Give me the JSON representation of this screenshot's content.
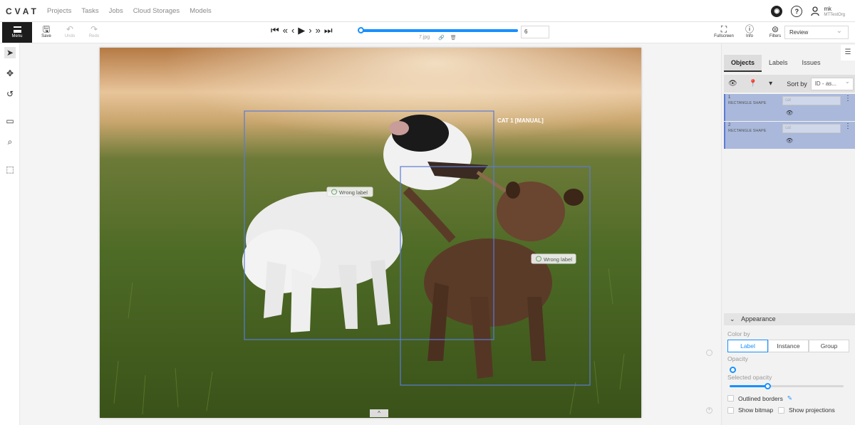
{
  "app": {
    "logo": "CVAT"
  },
  "nav": [
    "Projects",
    "Tasks",
    "Jobs",
    "Cloud Storages",
    "Models"
  ],
  "header_icons": [
    "github-icon",
    "help-icon",
    "user-icon"
  ],
  "user": {
    "name": "mk",
    "org": "MTTestOrg"
  },
  "toolbar": {
    "menu_label": "Menu",
    "save_label": "Save",
    "undo_label": "Undo",
    "redo_label": "Redo",
    "frame_number": "6",
    "frame_progress": 1.0,
    "filename": "7.jpg",
    "fullscreen_label": "Fullscreen",
    "info_label": "Info",
    "filters_label": "Filters",
    "mode_value": "Review"
  },
  "canvas": {
    "box1_label": "CAT 1 [MANUAL]",
    "issue1_text": "Wrong label",
    "issue2_text": "Wrong label"
  },
  "sidebar": {
    "tabs": [
      "Objects",
      "Labels",
      "Issues"
    ],
    "sort_label": "Sort by",
    "sort_value": "ID - as...",
    "objects": [
      {
        "id": "1",
        "type": "RECTANGLE SHAPE",
        "label": "cat"
      },
      {
        "id": "2",
        "type": "RECTANGLE SHAPE",
        "label": "cat"
      }
    ]
  },
  "appearance": {
    "title": "Appearance",
    "color_by_label": "Color by",
    "color_by_options": [
      "Label",
      "Instance",
      "Group"
    ],
    "color_by_selected": "Label",
    "opacity_label": "Opacity",
    "opacity_value": 0,
    "selected_opacity_label": "Selected opacity",
    "selected_opacity_value": 0.3,
    "outlined_borders_label": "Outlined borders",
    "show_bitmap_label": "Show bitmap",
    "show_projections_label": "Show projections"
  },
  "colors": {
    "accent": "#1890ff",
    "object_bg": "#a9b8db",
    "box_stroke": "#5b7bd5"
  }
}
